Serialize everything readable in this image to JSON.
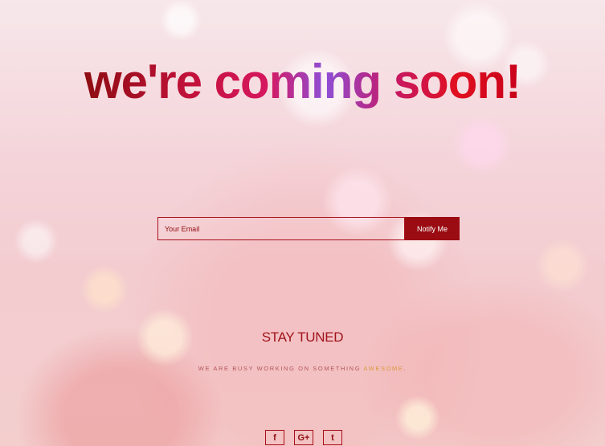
{
  "hero": {
    "headline": "we're coming soon!"
  },
  "subscribe": {
    "email_placeholder": "Your Email",
    "email_value": "",
    "notify_label": "Notify Me"
  },
  "tagline": {
    "title": "STAY TUNED",
    "message_part1": "WE ARE BUSY WORKING ON SOMETHING ",
    "message_highlight": "AWESOME",
    "message_part2": "."
  },
  "social": [
    {
      "icon": "facebook-icon",
      "glyph": "f"
    },
    {
      "icon": "google-plus-icon",
      "glyph": "G+"
    },
    {
      "icon": "tumblr-icon",
      "glyph": "t"
    }
  ],
  "colors": {
    "accent": "#9a0c12",
    "highlight": "#d89a3b"
  }
}
